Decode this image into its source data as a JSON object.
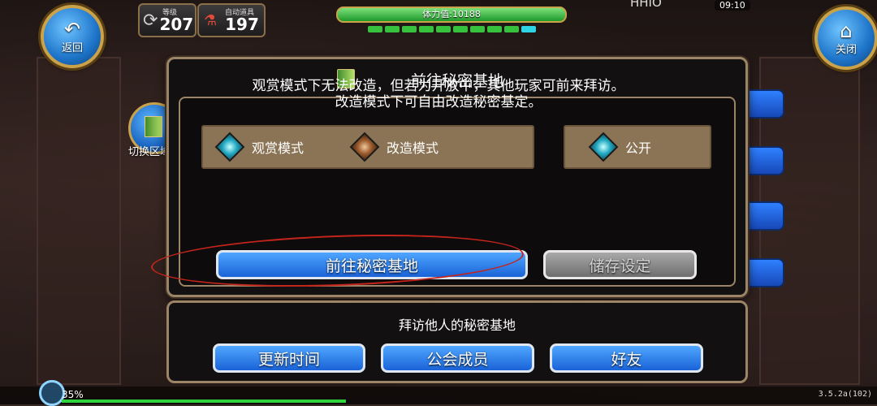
{
  "hud": {
    "back_label": "返回",
    "close_label": "关闭",
    "level_label": "等级",
    "level_value": "207",
    "item_label": "自动道具",
    "item_value": "197",
    "stamina_text": "体力值:10188",
    "time_text": "09:10",
    "top_name": "HHIO",
    "switch_label": "切换区域"
  },
  "dialog": {
    "title": "前往秘密基地",
    "description_line1": "观赏模式下无法改造，但若为开放中，其他玩家可前来拜访。",
    "description_line2": "改造模式下可自由改造秘密基定。",
    "mode_view": "观赏模式",
    "mode_edit": "改造模式",
    "public_label": "公开",
    "goto_button": "前往秘密基地",
    "save_button": "储存设定"
  },
  "visit": {
    "title": "拜访他人的秘密基地",
    "buttons": [
      "更新时间",
      "公会成员",
      "好友"
    ]
  },
  "bottom": {
    "percent": "35%",
    "progress": 0.35,
    "version": "3.5.2a(102)"
  },
  "colors": {
    "accent_blue": "#1a63d8",
    "gold_border": "#c9a24a",
    "annotation_red": "#c3241b"
  }
}
